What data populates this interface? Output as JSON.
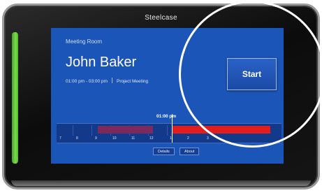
{
  "device": {
    "brand": "Steelcase"
  },
  "screen": {
    "room_label": "Meeting Room",
    "organizer_name": "John Baker",
    "time_range": "01:00 pm - 03:00 pm",
    "meeting_title": "Project Meeting",
    "current_time": "01:00 pm",
    "timeline": {
      "hours": [
        "7",
        "8",
        "9",
        "10",
        "11",
        "12",
        "1",
        "2",
        "3"
      ],
      "colors": {
        "past_booking": "#7b2a5e",
        "current_booking": "#e11d1d",
        "background": "#13398a"
      }
    },
    "buttons": {
      "details": "Details",
      "about": "About"
    },
    "start_button": "Start"
  },
  "colors": {
    "screen": "#1c55b8",
    "led": "#5cc43a"
  }
}
